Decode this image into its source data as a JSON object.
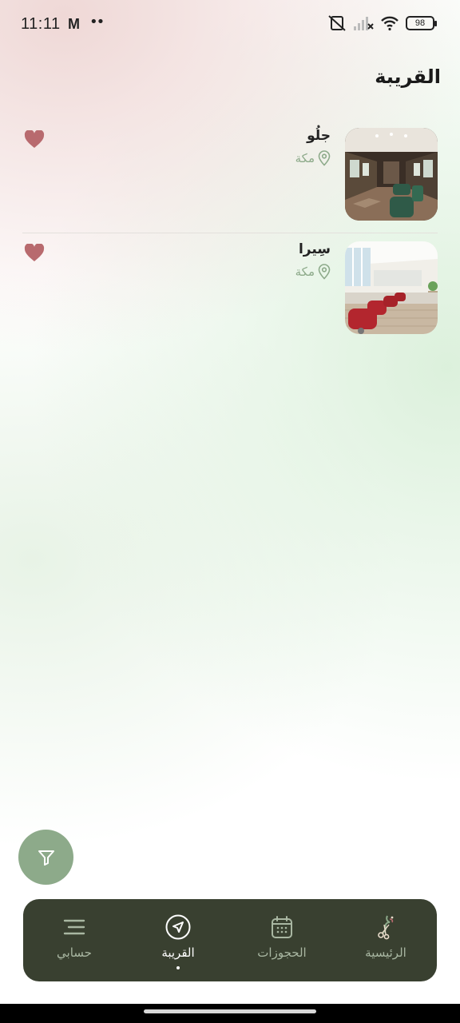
{
  "status_bar": {
    "time": "11:11",
    "mail_icon": "M",
    "dots": "••",
    "battery": "98"
  },
  "page_title": "القريبة",
  "salons": [
    {
      "name": "جلُو",
      "location": "مكة",
      "favorited": true
    },
    {
      "name": "سِيرا",
      "location": "مكة",
      "favorited": true
    }
  ],
  "bottom_nav": {
    "items": [
      {
        "label": "الرئيسية",
        "icon": "scissors-logo-icon",
        "active": false
      },
      {
        "label": "الحجوزات",
        "icon": "calendar-icon",
        "active": false
      },
      {
        "label": "القريبة",
        "icon": "navigation-arrow-icon",
        "active": true
      },
      {
        "label": "حسابي",
        "icon": "menu-icon",
        "active": false
      }
    ]
  },
  "colors": {
    "accent_green": "#8daa8a",
    "nav_background": "#394030",
    "heart": "#b86a6e"
  }
}
